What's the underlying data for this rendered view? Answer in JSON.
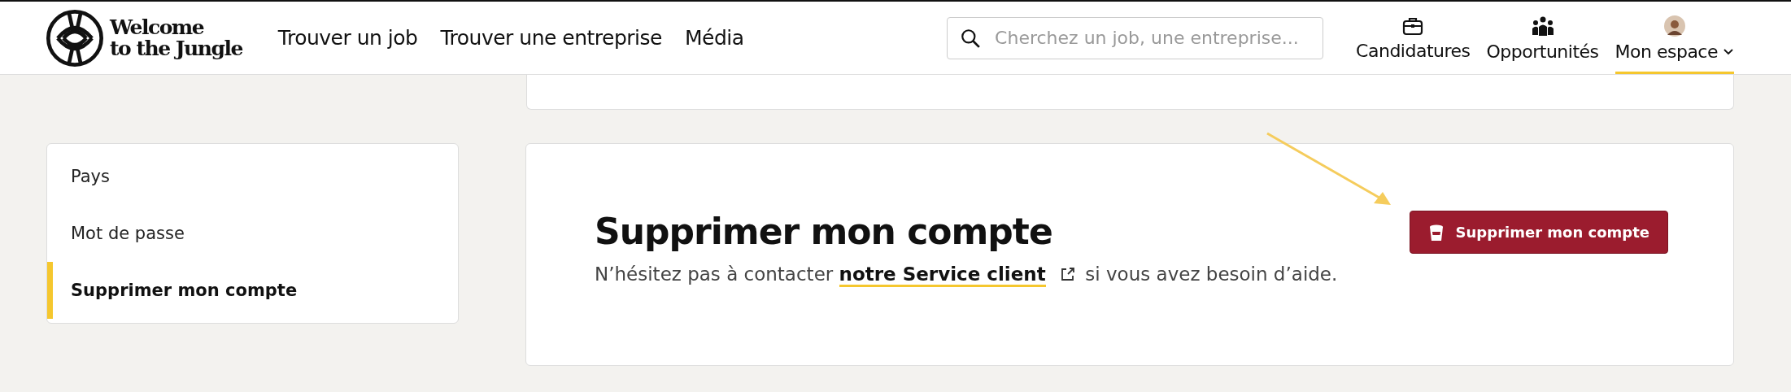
{
  "header": {
    "logo_lines": [
      "Welcome",
      "to the Jungle"
    ],
    "nav": [
      "Trouver un job",
      "Trouver une entreprise",
      "Média"
    ],
    "search": {
      "placeholder": "Cherchez un job, une entreprise..."
    },
    "actions": [
      {
        "kind": "briefcase",
        "label": "Candidatures",
        "selected": false
      },
      {
        "kind": "people",
        "label": "Opportunités",
        "selected": false
      },
      {
        "kind": "avatar",
        "label": "Mon espace",
        "selected": true
      }
    ]
  },
  "sidebar": {
    "items": [
      {
        "label": "Pays",
        "selected": false
      },
      {
        "label": "Mot de passe",
        "selected": false
      },
      {
        "label": "Supprimer mon compte",
        "selected": true
      }
    ]
  },
  "delete_card": {
    "title": "Supprimer mon compte",
    "text_before": "N’hésitez pas à contacter ",
    "link": "notre Service client",
    "text_after": " si vous avez besoin d’aide.",
    "button": "Supprimer mon compte"
  }
}
